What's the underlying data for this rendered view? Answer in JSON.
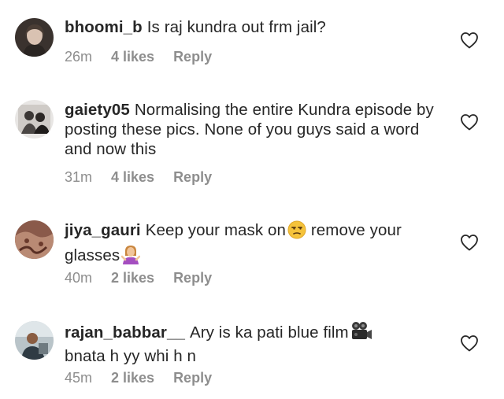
{
  "comments": [
    {
      "username": "bhoomi_b",
      "text": "Is raj kundra out frm jail?",
      "time": "26m",
      "likes": "4 likes",
      "reply_label": "Reply"
    },
    {
      "username": "gaiety05",
      "text": "Normalising the entire Kundra episode by posting these pics. None of you guys said a word and now this",
      "time": "31m",
      "likes": "4 likes",
      "reply_label": "Reply"
    },
    {
      "username": "jiya_gauri",
      "text_before": "Keep your mask on",
      "text_after": " remove your glasses",
      "emoji_1": "unamused-face-icon",
      "emoji_2": "woman-shrugging-icon",
      "time": "40m",
      "likes": "2 likes",
      "reply_label": "Reply"
    },
    {
      "username": "rajan_babbar__",
      "text": "Ary is ka pati blue film",
      "text_after": "bnata h yy whi h n",
      "emoji_1": "movie-camera-icon",
      "time": "45m",
      "likes": "2 likes",
      "reply_label": "Reply"
    }
  ],
  "icons": {
    "like": "heart-outline-icon"
  },
  "colors": {
    "text": "#262626",
    "meta": "#8e8e8e"
  }
}
